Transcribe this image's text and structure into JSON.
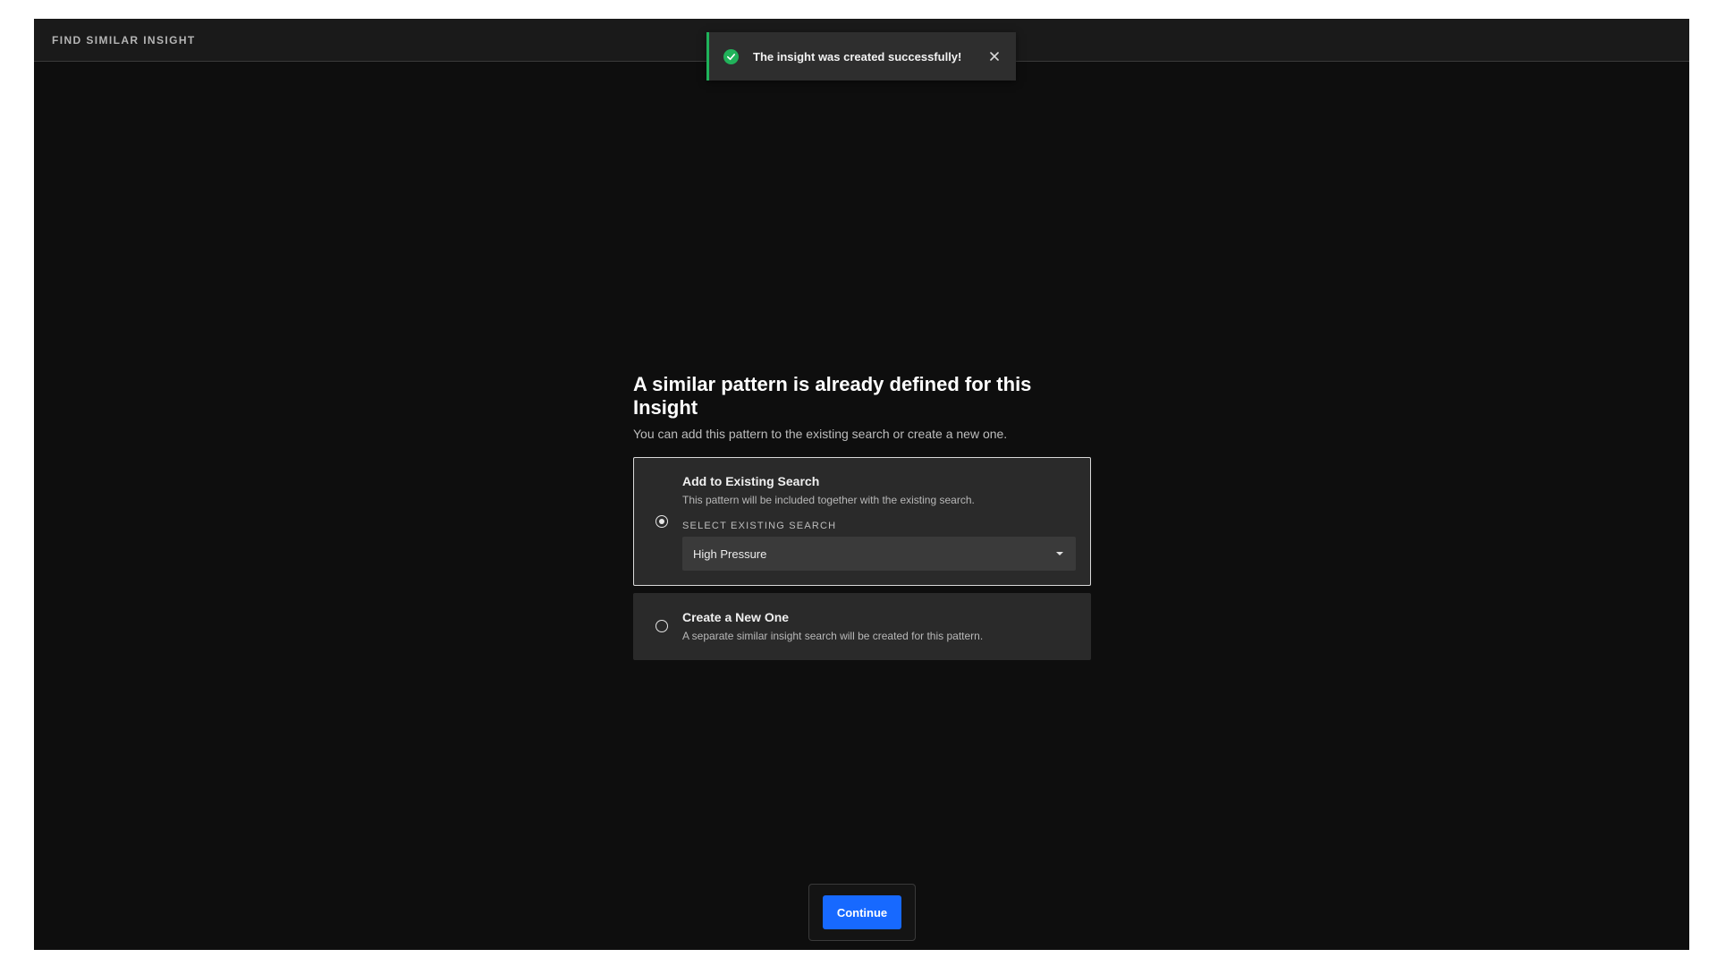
{
  "header": {
    "title": "FIND SIMILAR INSIGHT"
  },
  "toast": {
    "message": "The insight was created successfully!",
    "status_icon": "check-circle-icon",
    "close_icon": "close-icon",
    "accent_color": "#21b25a"
  },
  "main": {
    "heading": "A similar pattern is already defined for this Insight",
    "subheading": "You can add this pattern to the existing search or create a new one.",
    "options": [
      {
        "title": "Add to Existing Search",
        "description": "This pattern will be included together with the existing search.",
        "selected": true,
        "select_label": "SELECT EXISTING SEARCH",
        "select_value": "High Pressure"
      },
      {
        "title": "Create a New One",
        "description": "A separate similar insight search will be created for this pattern.",
        "selected": false
      }
    ]
  },
  "footer": {
    "continue_label": "Continue",
    "button_color": "#1769ff"
  }
}
